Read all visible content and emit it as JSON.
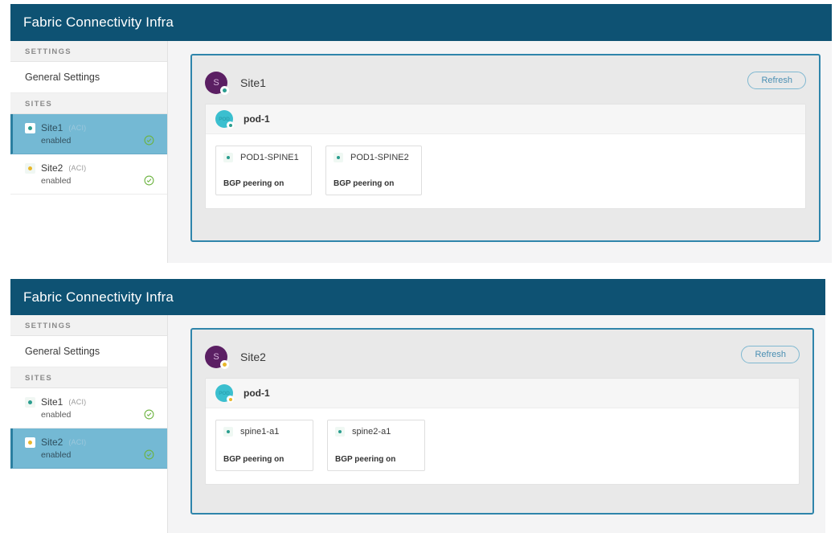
{
  "panels": [
    {
      "header": {
        "title": "Fabric Connectivity Infra"
      },
      "sidebar": {
        "sections": [
          {
            "label": "SETTINGS"
          },
          {
            "label": "SITES"
          }
        ],
        "general_settings_label": "General Settings",
        "sites": [
          {
            "name": "Site1",
            "type": "(ACI)",
            "state": "enabled",
            "badge_color": "#2a9d8f",
            "status_icon": "check-circle-icon",
            "selected": true
          },
          {
            "name": "Site2",
            "type": "(ACI)",
            "state": "enabled",
            "badge_color": "#e8b72c",
            "status_icon": "check-circle-icon",
            "selected": false
          }
        ]
      },
      "card": {
        "avatar_letter": "S",
        "avatar_badge_color": "#2a9d8f",
        "title": "Site1",
        "refresh_label": "Refresh",
        "pod": {
          "avatar_text": "POD",
          "avatar_badge_color": "#2a9d8f",
          "name": "pod-1",
          "nodes": [
            {
              "name": "POD1-SPINE1",
              "state": "BGP peering on",
              "badge_color": "#2a9d8f"
            },
            {
              "name": "POD1-SPINE2",
              "state": "BGP peering on",
              "badge_color": "#2a9d8f"
            }
          ]
        }
      }
    },
    {
      "header": {
        "title": "Fabric Connectivity Infra"
      },
      "sidebar": {
        "sections": [
          {
            "label": "SETTINGS"
          },
          {
            "label": "SITES"
          }
        ],
        "general_settings_label": "General Settings",
        "sites": [
          {
            "name": "Site1",
            "type": "(ACI)",
            "state": "enabled",
            "badge_color": "#2a9d8f",
            "status_icon": "check-circle-icon",
            "selected": false
          },
          {
            "name": "Site2",
            "type": "(ACI)",
            "state": "enabled",
            "badge_color": "#e8b72c",
            "status_icon": "check-circle-icon",
            "selected": true
          }
        ]
      },
      "card": {
        "avatar_letter": "S",
        "avatar_badge_color": "#e8b72c",
        "title": "Site2",
        "refresh_label": "Refresh",
        "pod": {
          "avatar_text": "POD",
          "avatar_badge_color": "#e8b72c",
          "name": "pod-1",
          "nodes": [
            {
              "name": "spine1-a1",
              "state": "BGP peering on",
              "badge_color": "#2a9d8f"
            },
            {
              "name": "spine2-a1",
              "state": "BGP peering on",
              "badge_color": "#2a9d8f"
            }
          ]
        }
      }
    }
  ],
  "colors": {
    "header_bar": "#0e5273",
    "selected_row": "#74b9d4",
    "card_border": "#2f85ab",
    "refresh_border": "#7fb8d1",
    "status_green": "#6cb33f"
  }
}
